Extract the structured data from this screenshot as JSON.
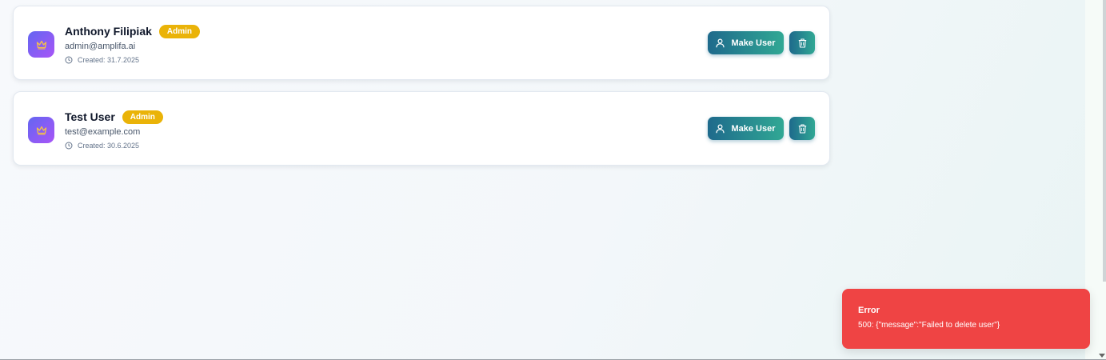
{
  "users": [
    {
      "name": "Anthony Filipiak",
      "role_badge": "Admin",
      "email": "admin@amplifa.ai",
      "created": "Created: 31.7.2025",
      "make_user_label": "Make User"
    },
    {
      "name": "Test User",
      "role_badge": "Admin",
      "email": "test@example.com",
      "created": "Created: 30.6.2025",
      "make_user_label": "Make User"
    }
  ],
  "toast": {
    "title": "Error",
    "message": "500: {\"message\":\"Failed to delete user\"}"
  },
  "icons": {
    "avatar": "crown-icon",
    "created": "clock-icon",
    "make_user": "user-icon",
    "delete": "trash-icon"
  },
  "colors": {
    "admin_badge": "#eab308",
    "button_gradient_start": "#1e6a8c",
    "button_gradient_end": "#31a894",
    "avatar_gradient_start": "#6366f1",
    "avatar_gradient_end": "#a855f7",
    "toast_error": "#ef4444"
  }
}
